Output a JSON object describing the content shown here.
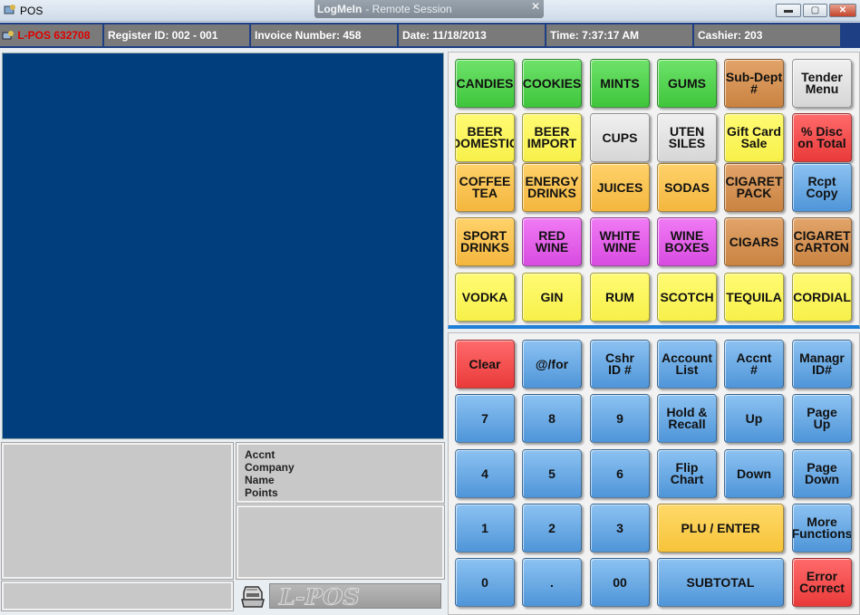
{
  "window": {
    "title": "POS",
    "logmein_brand": "LogMeIn",
    "logmein_session": "Remote Session",
    "min_glyph": "▬",
    "max_glyph": "▢",
    "close_glyph": "✕",
    "logmein_close_glyph": "✕"
  },
  "status": {
    "lpos": "L-POS 632708",
    "register": "Register ID: 002 - 001",
    "invoice": "Invoice Number: 458",
    "date": "Date: 11/18/2013",
    "time": "Time: 7:37:17 AM",
    "cashier": "Cashier: 203"
  },
  "account": {
    "labels": [
      "Accnt",
      "Company",
      "Name",
      "Points"
    ]
  },
  "logo_text": "L-POS",
  "departments": [
    {
      "label": "CANDIES",
      "color": "green"
    },
    {
      "label": "COOKIES",
      "color": "green"
    },
    {
      "label": "MINTS",
      "color": "green"
    },
    {
      "label": "GUMS",
      "color": "green"
    },
    {
      "label": "Sub-Dept\n#",
      "color": "brown"
    },
    {
      "label": "Tender\nMenu",
      "color": "grey"
    },
    {
      "label": "BEER\nDOMESTIC",
      "color": "yellow"
    },
    {
      "label": "BEER\nIMPORT",
      "color": "yellow"
    },
    {
      "label": "CUPS",
      "color": "grey"
    },
    {
      "label": "UTEN\nSILES",
      "color": "grey"
    },
    {
      "label": "Gift Card\nSale",
      "color": "yellow"
    },
    {
      "label": "% Disc\non Total",
      "color": "red"
    },
    {
      "label": "COFFEE\nTEA",
      "color": "orange"
    },
    {
      "label": "ENERGY\nDRINKS",
      "color": "orange"
    },
    {
      "label": "JUICES",
      "color": "orange"
    },
    {
      "label": "SODAS",
      "color": "orange"
    },
    {
      "label": "CIGARET\nPACK",
      "color": "brown"
    },
    {
      "label": "Rcpt\nCopy",
      "color": "blue"
    },
    {
      "label": "SPORT\nDRINKS",
      "color": "orange"
    },
    {
      "label": "RED\nWINE",
      "color": "purple"
    },
    {
      "label": "WHITE\nWINE",
      "color": "purple"
    },
    {
      "label": "WINE\nBOXES",
      "color": "purple"
    },
    {
      "label": "CIGARS",
      "color": "brown"
    },
    {
      "label": "CIGARET\nCARTON",
      "color": "brown"
    },
    {
      "label": "VODKA",
      "color": "yellow"
    },
    {
      "label": "GIN",
      "color": "yellow"
    },
    {
      "label": "RUM",
      "color": "yellow"
    },
    {
      "label": "SCOTCH",
      "color": "yellow"
    },
    {
      "label": "TEQUILA",
      "color": "yellow"
    },
    {
      "label": "CORDIAL",
      "color": "yellow"
    }
  ],
  "keypad": [
    {
      "label": "Clear",
      "color": "red",
      "name": "clear-button"
    },
    {
      "label": "@/for",
      "color": "blue",
      "name": "at-for-button"
    },
    {
      "label": "Cshr\nID #",
      "color": "blue",
      "name": "cashier-id-button"
    },
    {
      "label": "Account\nList",
      "color": "blue",
      "name": "account-list-button"
    },
    {
      "label": "Accnt\n#",
      "color": "blue",
      "name": "account-number-button"
    },
    {
      "label": "Managr\nID#",
      "color": "blue",
      "name": "manager-id-button"
    },
    {
      "label": "7",
      "color": "blue",
      "name": "key-7"
    },
    {
      "label": "8",
      "color": "blue",
      "name": "key-8"
    },
    {
      "label": "9",
      "color": "blue",
      "name": "key-9"
    },
    {
      "label": "Hold &\nRecall",
      "color": "blue",
      "name": "hold-recall-button"
    },
    {
      "label": "Up",
      "color": "blue",
      "name": "up-button"
    },
    {
      "label": "Page\nUp",
      "color": "blue",
      "name": "page-up-button"
    },
    {
      "label": "4",
      "color": "blue",
      "name": "key-4"
    },
    {
      "label": "5",
      "color": "blue",
      "name": "key-5"
    },
    {
      "label": "6",
      "color": "blue",
      "name": "key-6"
    },
    {
      "label": "Flip\nChart",
      "color": "blue",
      "name": "flip-chart-button"
    },
    {
      "label": "Down",
      "color": "blue",
      "name": "down-button"
    },
    {
      "label": "Page\nDown",
      "color": "blue",
      "name": "page-down-button"
    },
    {
      "label": "1",
      "color": "blue",
      "name": "key-1"
    },
    {
      "label": "2",
      "color": "blue",
      "name": "key-2"
    },
    {
      "label": "3",
      "color": "blue",
      "name": "key-3"
    },
    {
      "label": "PLU / ENTER",
      "color": "kyellow",
      "name": "plu-enter-button",
      "span": 2
    },
    {
      "label": "More\nFunctions",
      "color": "blue",
      "name": "more-functions-button"
    },
    {
      "label": "0",
      "color": "blue",
      "name": "key-0"
    },
    {
      "label": ".",
      "color": "blue",
      "name": "key-decimal"
    },
    {
      "label": "00",
      "color": "blue",
      "name": "key-00"
    },
    {
      "label": "SUBTOTAL",
      "color": "blue",
      "name": "subtotal-button",
      "span": 2
    },
    {
      "label": "Error\nCorrect",
      "color": "red",
      "name": "error-correct-button"
    }
  ]
}
